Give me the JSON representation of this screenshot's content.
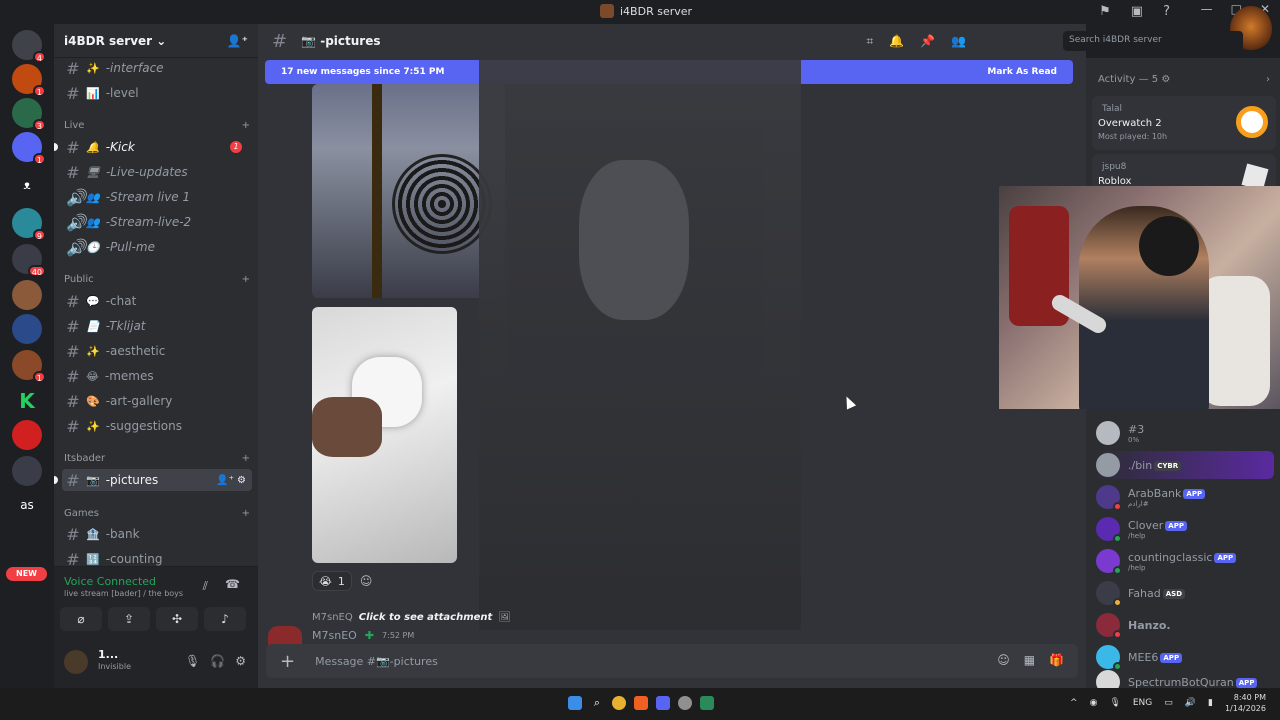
{
  "window": {
    "title": "i4BDR server",
    "min": "—",
    "max": "□",
    "close": "✕"
  },
  "guilds": {
    "badges": [
      "4",
      "1",
      "3",
      "1",
      "9",
      "40",
      "1"
    ],
    "new_label": "NEW",
    "text_guild": "as"
  },
  "server": {
    "name": "i4BDR server"
  },
  "channels": {
    "top": [
      {
        "label": "-interface",
        "emoji": "✨"
      },
      {
        "label": "-level",
        "emoji": "📊"
      }
    ],
    "live_cat": "Live",
    "live": [
      {
        "label": "-Kick",
        "emoji": "🔔",
        "badge": "1"
      },
      {
        "label": "-Live-updates",
        "emoji": "🖥"
      },
      {
        "label": "-Stream live 1",
        "emoji": "👥"
      },
      {
        "label": "-Stream-live-2",
        "emoji": "👥"
      },
      {
        "label": "-Pull-me",
        "emoji": "🕒"
      }
    ],
    "public_cat": "Public",
    "public": [
      {
        "label": "-chat",
        "emoji": "💬"
      },
      {
        "label": "-Tklijat",
        "emoji": "📄"
      },
      {
        "label": "-aesthetic",
        "emoji": "✨"
      },
      {
        "label": "-memes",
        "emoji": "😂"
      },
      {
        "label": "-art-gallery",
        "emoji": "🎨"
      },
      {
        "label": "-suggestions",
        "emoji": "✨"
      }
    ],
    "itsbader_cat": "Itsbader",
    "itsbader": [
      {
        "label": "-pictures",
        "emoji": "📷"
      }
    ],
    "games_cat": "Games",
    "games": [
      {
        "label": "-bank",
        "emoji": "🏦"
      },
      {
        "label": "-counting",
        "emoji": "🔢"
      }
    ]
  },
  "voice": {
    "title": "Voice Connected",
    "sub": "live stream [bader] / the boys"
  },
  "user": {
    "name": "1...",
    "status": "Invisible"
  },
  "header": {
    "channel": "📷 -pictures",
    "search_placeholder": "Search i4BDR server"
  },
  "banner": {
    "text": "17 new messages since 7:51 PM",
    "action": "Mark As Read"
  },
  "reactions": [
    {
      "emoji": "😭",
      "count": "1"
    }
  ],
  "reply": {
    "user": "M7snEQ",
    "text": "Click to see attachment"
  },
  "message": {
    "author": "M7snEO",
    "time": "7:52 PM"
  },
  "composer": {
    "placeholder": "Message #📷-pictures"
  },
  "activity": {
    "header": "Activity — 5",
    "cards": [
      {
        "user": "Talal",
        "game": "Overwatch 2",
        "sub": "Most played: 10h"
      },
      {
        "user": "jspu8",
        "game": "Roblox",
        "sub": ""
      }
    ]
  },
  "members": [
    {
      "name": "#3",
      "sub": "0%",
      "color": "#b5bac1"
    },
    {
      "name": "./bin",
      "tag": "CYBR",
      "sub": "",
      "color": "#949ba4"
    },
    {
      "name": "ArabBank",
      "tag": "APP",
      "sub": "ارادم#",
      "color": "#4e3a8a"
    },
    {
      "name": "Clover",
      "tag": "APP",
      "sub": "/help",
      "color": "#5a2ab0"
    },
    {
      "name": "countingclassic",
      "tag": "APP",
      "sub": "/help",
      "color": "#7a3ad0"
    },
    {
      "name": "Fahad",
      "tag": "ASD",
      "sub": "",
      "color": "#3a3d48"
    },
    {
      "name": "Hanzo.",
      "sub": "",
      "color": "#8a2a3a"
    },
    {
      "name": "MEE6",
      "tag": "APP",
      "sub": "",
      "color": "#3ab8e8"
    },
    {
      "name": "SpectrumBotQuran",
      "tag": "APP",
      "sub": "",
      "color": "#d8d8d8"
    }
  ],
  "taskbar": {
    "lang": "ENG",
    "time": "8:40 PM",
    "date": "1/14/2026"
  }
}
